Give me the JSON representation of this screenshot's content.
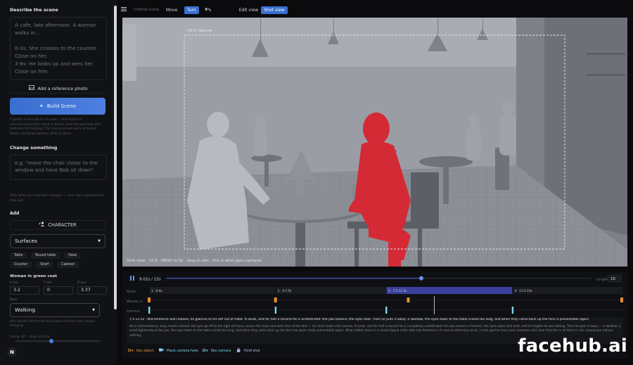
{
  "sidebar": {
    "describe_title": "Describe the scene",
    "describe_text": "A cafe, late afternoon. A woman walks in...\n\n0-3s: She crosses to the counter. Close on her.\n3-6s: He looks up and sees her. Close on him.",
    "ref_photo_label": "Add a reference photo",
    "build_label": "Build Scene",
    "build_hint": "A photo is enough on its own — the layout is reconstructed from what it shows, and the opening shot matches its framing. The scene comes back as tinted boxes, building replaces what is there.",
    "change_title": "Change something",
    "change_placeholder": "e.g. \"move the chair closer to the window and have Bob sit down\"",
    "change_hint": "Only what you mention changes — your own adjustments stay put.",
    "add_label": "Add",
    "character_label": "CHARACTER",
    "surfaces_label": "Surfaces",
    "surface_items": [
      "Table",
      "Round table",
      "Desk",
      "Counter",
      "Shelf",
      "Cabinet"
    ],
    "object_title": "Woman in green coat",
    "x_label": "X (m)",
    "x_value": "3.2",
    "y_label": "Y (m)",
    "y_value": "0",
    "z_label": "Z (m)",
    "z_value": "3.37",
    "pose_label": "Pose",
    "pose_value": "Walking",
    "pose_hint": "Also blends with the left leg forward and the arms around swinging.",
    "facing_label": "Facing -40° · stays at 0.43s",
    "logo": "N"
  },
  "toolbar": {
    "scene_name": "Untitled scene",
    "move": "Move",
    "turn": "Turn",
    "undo_icon": "undo-icon",
    "edit_view": "Edit view",
    "shot_view": "Shot view"
  },
  "viewport": {
    "capture_label": "16:9 capture",
    "status": "Shot view · 16:9 · WASD to fly · drag to aim · this is what gets captured"
  },
  "timeline": {
    "time": "9.02s / 15s",
    "playhead": 0.601,
    "length_label": "Length",
    "length_value": "15",
    "total": 15,
    "rows": [
      "Shots",
      "Woman in",
      "Camera"
    ],
    "shots": [
      {
        "label": "1 · 0-4s",
        "start": 0,
        "end": 4,
        "active": false
      },
      {
        "label": "2 · 4-7.5s",
        "start": 4,
        "end": 7.5,
        "active": false
      },
      {
        "label": "3 · 7.5-11.5s",
        "start": 7.5,
        "end": 11.5,
        "active": true
      },
      {
        "label": "4 · 11.5-15s",
        "start": 11.5,
        "end": 15,
        "active": false
      }
    ],
    "woman_keys": [
      0,
      4,
      8.2,
      15
    ],
    "camera_keys": [
      0,
      4,
      7.5,
      11.5
    ],
    "shot_title": "7.5-11.5s · Mid-sentence and relaxed, he glances to his left out of habit. It lands, and for half a second he is undefended: the jaw loosens, the eyes hold. Then he puts it away: a swallow, the eyes down to the table a beat too long, and when they come back up the face is presentable again.",
    "shot_desc": "He is mid-sentence, easy, hands relaxed. His eyes go off to the right of frame, across the room and well clear of the lens — he never looks into camera. It lands, and for half a second he is completely undefended: the jaw loosens a fraction, the eyes warm and hold, and he forgets he was talking. Then he puts it away — a swallow, a small tightening at the jaw, the eyes down to the table a beat too long, and when they come back up the face has been made presentable again. What settles there is a closed-lipped smile with real fondness in it and no bitterness at all, a man glad to have seen someone and clear that this is all there is. His companion notices nothing."
  },
  "guide": {
    "key_object": "Key object",
    "place_camera": "Place camera here",
    "key_camera": "Key camera",
    "hold_shot": "Hold shot"
  },
  "watermark": "facehub.ai",
  "colors": {
    "accent": "#3a6fd0",
    "figure_red": "#d42a35",
    "key_orange": "#e8902a",
    "key_cyan": "#7fd6f2"
  }
}
